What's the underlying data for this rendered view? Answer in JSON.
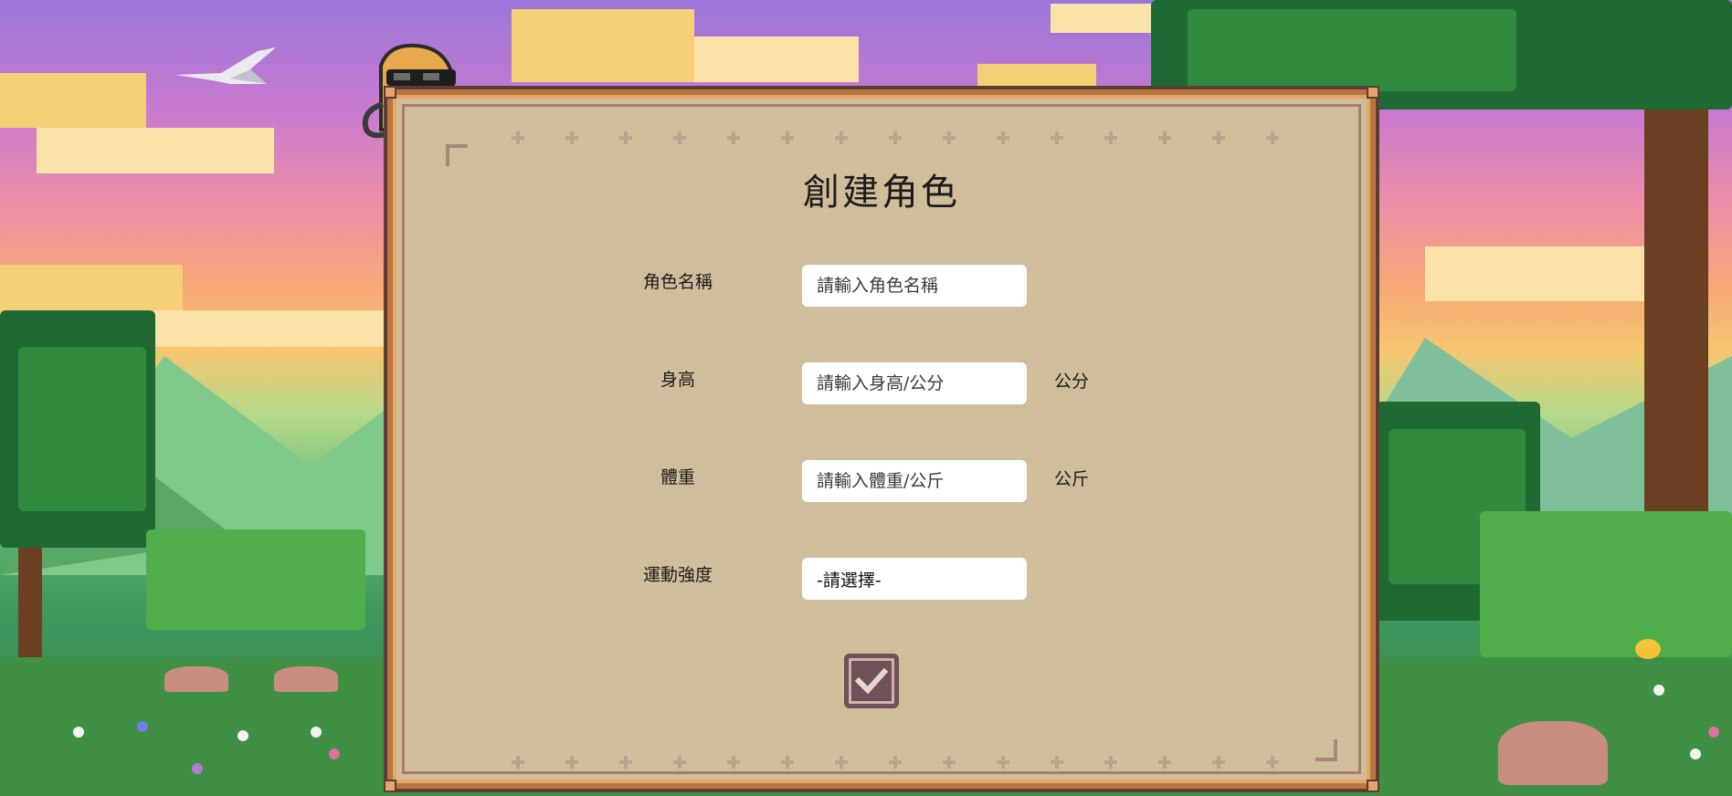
{
  "form": {
    "title": "創建角色",
    "fields": [
      {
        "label": "角色名稱",
        "placeholder": "請輸入角色名稱",
        "unit": ""
      },
      {
        "label": "身高",
        "placeholder": "請輸入身高/公分",
        "unit": "公分"
      },
      {
        "label": "體重",
        "placeholder": "請輸入體重/公斤",
        "unit": "公斤"
      },
      {
        "label": "運動強度",
        "selected": "-請選擇-"
      }
    ],
    "confirm_icon": "checkmark-icon"
  },
  "colors": {
    "panel_bg": "#cfbd9c",
    "panel_border": "#b9763f",
    "button_bg": "#6f5157"
  }
}
